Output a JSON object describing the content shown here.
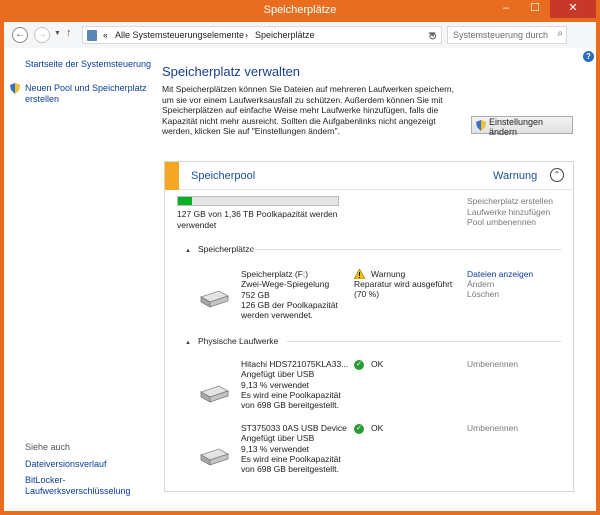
{
  "window": {
    "title": "Speicherplätze",
    "min": "–",
    "max": "☐",
    "close": "✕"
  },
  "address": {
    "back": "←",
    "forward": "→",
    "up": "↑",
    "prefix": "«",
    "crumb1": "Alle Systemsteuerungselemente",
    "sep": "›",
    "crumb2": "Speicherplätze",
    "refresh": "↻",
    "search_placeholder": "Systemsteuerung durchsuchen"
  },
  "left": {
    "home": "Startseite der Systemsteuerung",
    "new_pool": "Neuen Pool und Speicherplatz erstellen",
    "see_also": "Siehe auch",
    "history": "Dateiversionsverlauf",
    "bitlocker": "BitLocker-Laufwerksverschlüsselung"
  },
  "main": {
    "heading": "Speicherplatz verwalten",
    "description": "Mit Speicherplätzen können Sie Dateien auf mehreren Laufwerken speichern, um sie vor einem Laufwerksausfall zu schützen. Außerdem können Sie mit Speicherplätzen auf einfache Weise mehr Laufwerke hinzufügen, falls die Kapazität nicht mehr ausreicht. Sollten die Aufgabenlinks nicht angezeigt werden, klicken Sie auf \"Einstellungen ändern\".",
    "settings_button": "Einstellungen ändern"
  },
  "pool": {
    "title": "Speicherpool",
    "status": "Warnung",
    "usage_fraction": 0.09,
    "usage_text": "127 GB von 1,36 TB Poolkapazität werden verwendet",
    "actions": [
      "Speicherplatz erstellen",
      "Laufwerke hinzufügen",
      "Pool umbenennen"
    ],
    "spaces_header": "Speicherplätze",
    "space": {
      "name": "Speicherplatz (F:)",
      "type": "Zwei-Wege-Spiegelung",
      "size": "752 GB",
      "used": "126 GB der Poolkapazität werden verwendet.",
      "status": "Warnung",
      "status_detail": "Reparatur wird ausgeführt (70 %)",
      "links": [
        "Dateien anzeigen",
        "Ändern",
        "Löschen"
      ]
    },
    "drives_header": "Physische Laufwerke",
    "drives": [
      {
        "name": "Hitachi HDS721075KLA33...",
        "connection": "Angefügt über USB",
        "used": "9,13 % verwendet",
        "capacity": "Es wird eine Poolkapazität von 698 GB bereitgestellt.",
        "status": "OK",
        "link": "Umbenennen"
      },
      {
        "name": "ST375033 0AS USB Device",
        "connection": "Angefügt über USB",
        "used": "9,13 % verwendet",
        "capacity": "Es wird eine Poolkapazität von 698 GB bereitgestellt.",
        "status": "OK",
        "link": "Umbenennen"
      }
    ]
  },
  "help": "?",
  "ok_glyph": "✓",
  "collapse_glyph": "⌃",
  "colors": {
    "title_bar": "#e96d1f",
    "link": "#0d3d9a",
    "heading": "#1a3e8e",
    "warning_stripe": "#f5a623",
    "progress": "#06b025",
    "ok": "#2a9c3a"
  }
}
